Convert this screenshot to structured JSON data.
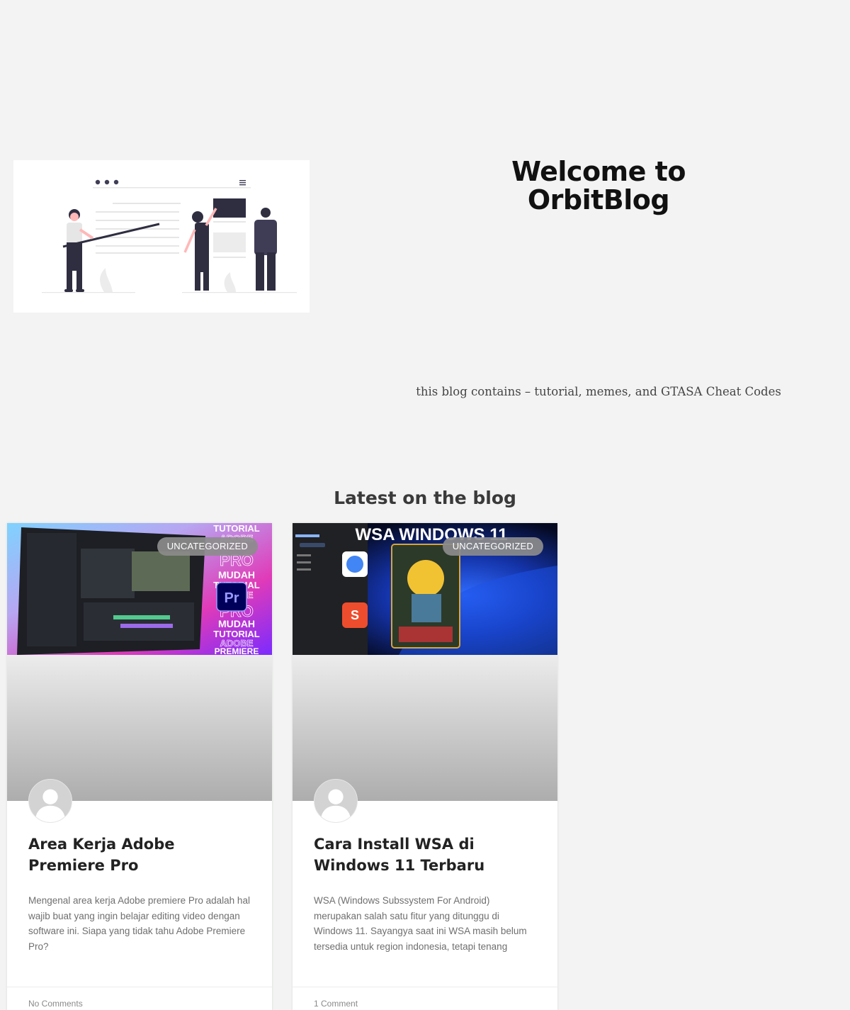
{
  "hero": {
    "title": "Welcome to OrbitBlog",
    "tagline": "this blog contains – tutorial, memes, and GTASA Cheat Codes"
  },
  "latest": {
    "heading": "Latest on the blog",
    "posts": [
      {
        "category": "UNCATEGORIZED",
        "title": "Area Kerja Adobe Premiere Pro",
        "excerpt": "Mengenal area kerja Adobe premiere Pro adalah hal wajib buat yang ingin belajar editing video dengan software ini. Siapa yang tidak tahu Adobe Premiere Pro?",
        "comments": "No Comments",
        "thumb_text": [
          "TUTORIAL",
          "ADOBE",
          "PRO",
          "MUDAH",
          "TUTORIAL",
          "ADOBE",
          "PRO",
          "MUDAH",
          "TUTORIAL",
          "ADOBE",
          "PREMIERE"
        ],
        "thumb_badge": "Pr"
      },
      {
        "category": "UNCATEGORIZED",
        "title": "Cara Install WSA di Windows 11 Terbaru",
        "excerpt": "WSA (Windows Subssystem For Android) merupakan salah satu fitur yang ditunggu di Windows 11. Sayangya saat ini WSA masih belum tersedia untuk region indonesia, tetapi tenang",
        "comments": "1 Comment",
        "thumb_text": [
          "WSA WINDOWS 11"
        ]
      }
    ]
  },
  "colors": {
    "page_bg": "#f2f3f2",
    "badge_bg": "#8c8c8c",
    "premiere_purple": "#9b3fe0",
    "windows_blue": "#1f4fd8"
  }
}
